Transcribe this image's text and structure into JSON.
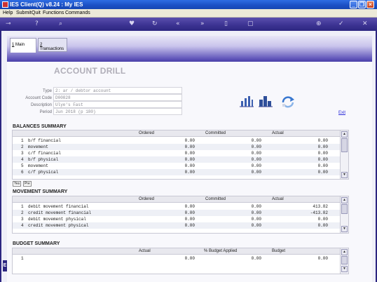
{
  "window": {
    "title": "IES Client(Q) v8.24 : My IES",
    "minimize_glyph": "_",
    "restore_glyph": "❐",
    "close_glyph": "×"
  },
  "menu": [
    "Help",
    "Submit",
    "Quit",
    "Functions",
    "Commands"
  ],
  "toolbar_icons": [
    "key-icon",
    "help-icon",
    "search-icon",
    "heart-icon",
    "refresh-icon",
    "rewind-icon",
    "fast-forward-icon",
    "print-icon",
    "copy-icon",
    "add-icon",
    "confirm-icon",
    "close-icon"
  ],
  "tabs": [
    {
      "num": "1",
      "label": " Main"
    },
    {
      "num": "2",
      "label": " Transactions"
    }
  ],
  "page": {
    "heading": "ACCOUNT DRILL",
    "exit_label": "Exit"
  },
  "fields": {
    "type_label": "Type",
    "type_value": "2: ar / debtor account",
    "code_label": "Account Code",
    "code_value": "D00828",
    "desc_label": "Description",
    "desc_value": "Ulye's Fast",
    "period_label": "Period",
    "period_value": "Jun 2018 (p 180)"
  },
  "balances": {
    "title": "BALANCES SUMMARY",
    "headers": {
      "c1": "Ordered",
      "c2": "Committed",
      "c3": "Actual"
    },
    "rows": [
      {
        "n": "1",
        "label": "b/f financial",
        "c1": "0.00",
        "c2": "0.00",
        "c3": "0.00"
      },
      {
        "n": "2",
        "label": "movement",
        "c1": "0.00",
        "c2": "0.00",
        "c3": "0.00"
      },
      {
        "n": "3",
        "label": "c/f financial",
        "c1": "0.00",
        "c2": "0.00",
        "c3": "0.00"
      },
      {
        "n": "4",
        "label": "b/f physical",
        "c1": "0.00",
        "c2": "0.00",
        "c3": "0.00"
      },
      {
        "n": "5",
        "label": "movement",
        "c1": "0.00",
        "c2": "0.00",
        "c3": "0.00"
      },
      {
        "n": "6",
        "label": "c/f physical",
        "c1": "0.00",
        "c2": "0.00",
        "c3": "0.00"
      }
    ],
    "btn_yes": "Yes",
    "btn_pre": "Pre"
  },
  "movement": {
    "title": "MOVEMENT SUMMARY",
    "headers": {
      "c1": "Ordered",
      "c2": "Committed",
      "c3": "Actual"
    },
    "rows": [
      {
        "n": "1",
        "label": "debit  movement financial",
        "c1": "0.00",
        "c2": "0.00",
        "c3": "413.82"
      },
      {
        "n": "2",
        "label": "credit movement financial",
        "c1": "0.00",
        "c2": "0.00",
        "c3": "-413.82"
      },
      {
        "n": "3",
        "label": "debit  movement physical",
        "c1": "0.00",
        "c2": "0.00",
        "c3": "0.00"
      },
      {
        "n": "4",
        "label": "credit movement physical",
        "c1": "0.00",
        "c2": "0.00",
        "c3": "0.00"
      }
    ]
  },
  "budget": {
    "title": "BUDGET SUMMARY",
    "headers": {
      "c1": "Actual",
      "c2": "% Budget Applied",
      "c3": "Budget"
    },
    "rows": [
      {
        "n": "1",
        "label": "",
        "c1": "0.00",
        "c2": "0.00",
        "c3": "0.00"
      }
    ]
  },
  "side_tab": "E"
}
